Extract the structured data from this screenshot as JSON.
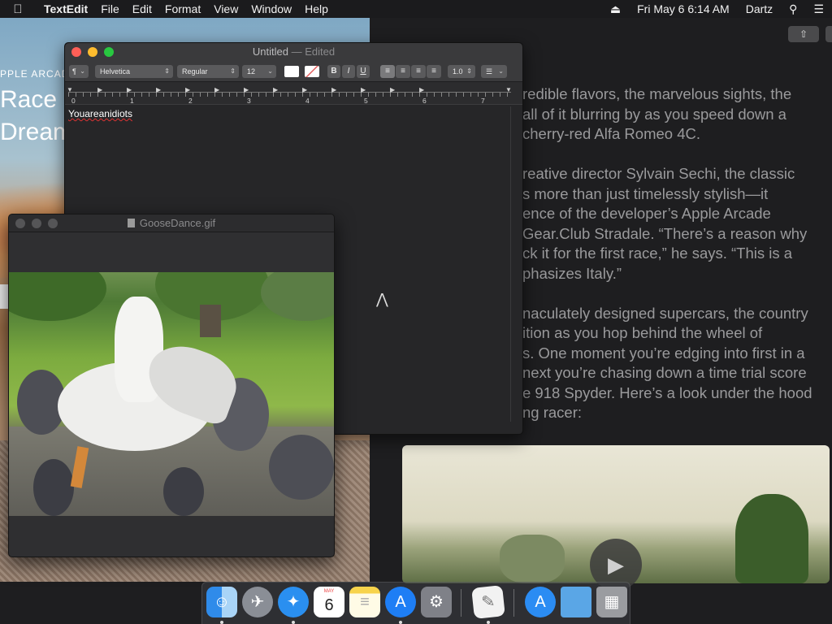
{
  "menubar": {
    "app_name": "TextEdit",
    "items": [
      "File",
      "Edit",
      "Format",
      "View",
      "Window",
      "Help"
    ],
    "datetime": "Fri May 6  6:14 AM",
    "user": "Dartz",
    "eject_icon": "eject-icon",
    "search_icon": "spotlight-search-icon",
    "menu_icon": "notification-center-icon"
  },
  "background_app": {
    "arcade_label": "PPLE ARCAD",
    "title_line1": "Race a",
    "title_line2": "Dream",
    "article_paragraphs": [
      [
        "redible flavors, the marvelous sights, the",
        " all of it blurring by as you speed down a",
        "cherry-red Alfa Romeo 4C."
      ],
      [
        "reative director Sylvain Sechi, the classic",
        "s more than just timelessly stylish—it",
        "ence of the developer’s Apple Arcade",
        " Gear.Club Stradale. “There’s a reason why",
        "ck it for the first race,” he says. “This is a",
        "phasizes Italy.”"
      ],
      [
        "naculately designed supercars, the country",
        "ition as you hop behind the wheel of",
        "s. One moment you’re edging into first in a",
        "next you’re chasing down a time trial score",
        "e 918 Spyder. Here’s a look under the hood",
        "ng racer:"
      ]
    ]
  },
  "textedit": {
    "title": "Untitled",
    "edited": " — Edited",
    "toolbar": {
      "paragraph_style": "¶",
      "font_family": "Helvetica",
      "font_style": "Regular",
      "font_size": "12",
      "bold": "B",
      "italic": "I",
      "underline": "U",
      "line_spacing": "1.0"
    },
    "ruler_numbers": [
      "0",
      "1",
      "2",
      "3",
      "4",
      "5",
      "6",
      "7"
    ],
    "body_text": "Youareanidiots"
  },
  "gif_window": {
    "title": "GooseDance.gif"
  },
  "dock": {
    "apps": [
      "finder-icon",
      "launchpad-icon",
      "safari-icon",
      "calendar-icon",
      "notes-icon",
      "app-store-icon",
      "system-preferences-icon",
      "textedit-icon",
      "applications-folder-icon",
      "documents-folder-icon",
      "trash-icon"
    ],
    "calendar_month": "MAY",
    "calendar_day": "6"
  },
  "colors": {
    "close": "#fe5f57",
    "minimize": "#febc2e",
    "maximize": "#28c840",
    "spell_error": "#dd3333"
  }
}
